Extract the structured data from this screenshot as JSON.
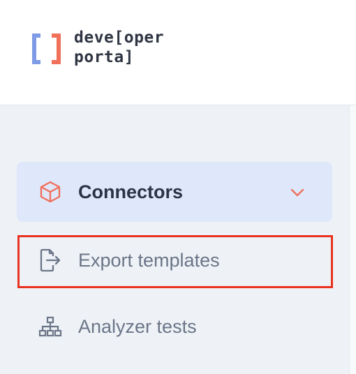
{
  "header": {
    "logo_line1": "deve[oper",
    "logo_line2": "porta]",
    "logo_icon": "bracket-logo-icon"
  },
  "sidebar": {
    "items": [
      {
        "label": "Connectors",
        "icon": "cube-icon",
        "active": true,
        "expandable": true
      },
      {
        "label": "Export templates",
        "icon": "file-export-icon",
        "active": false
      },
      {
        "label": "Analyzer tests",
        "icon": "sitemap-icon",
        "active": false
      }
    ]
  },
  "colors": {
    "accent_orange": "#f0705a",
    "accent_blue": "#7f9be6",
    "highlight_red": "#e8311e",
    "active_bg": "#dfe8fb"
  }
}
